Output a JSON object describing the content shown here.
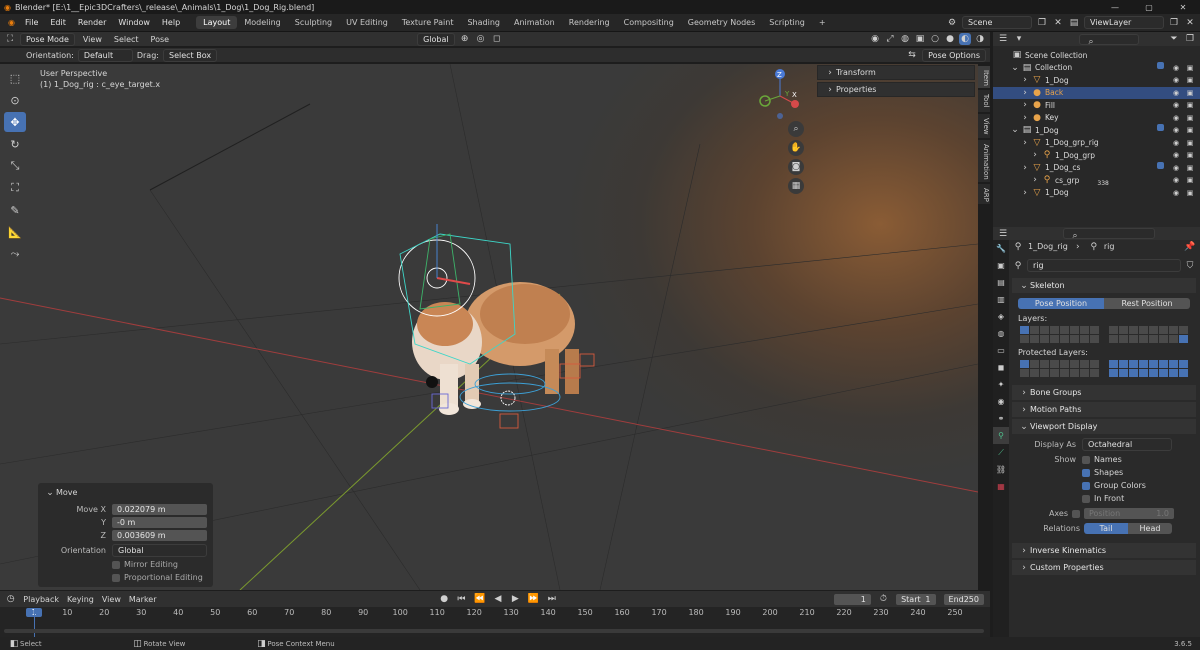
{
  "window": {
    "title": "Blender* [E:\\1__Epic3DCrafters\\_release\\_Animals\\1_Dog\\1_Dog_Rig.blend]",
    "min": "—",
    "max": "▢",
    "close": "✕"
  },
  "menu": [
    "File",
    "Edit",
    "Render",
    "Window",
    "Help"
  ],
  "workspaces": [
    "Layout",
    "Modeling",
    "Sculpting",
    "UV Editing",
    "Texture Paint",
    "Shading",
    "Animation",
    "Rendering",
    "Compositing",
    "Geometry Nodes",
    "Scripting"
  ],
  "workspace_add": "+",
  "scene": {
    "name": "Scene",
    "view_layer": "ViewLayer"
  },
  "viewport": {
    "mode": "Pose Mode",
    "menus": [
      "View",
      "Select",
      "Pose"
    ],
    "orientation_label": "Orientation:",
    "orientation": "Default",
    "drag_label": "Drag:",
    "drag": "Select Box",
    "transform": "Global",
    "pose_options": "Pose Options",
    "overlay_title": "User Perspective",
    "overlay_sub": "(1) 1_Dog_rig : c_eye_target.x",
    "side_items": [
      "Transform",
      "Properties"
    ],
    "tabs": [
      "Item",
      "Tool",
      "View",
      "Animation",
      "ARP"
    ],
    "gizmo": {
      "z": "Z",
      "x": "X",
      "y": "Y"
    }
  },
  "redo": {
    "title": "Move",
    "rows": [
      {
        "label": "Move X",
        "value": "0.022079 m"
      },
      {
        "label": "Y",
        "value": "-0 m"
      },
      {
        "label": "Z",
        "value": "0.003609 m"
      }
    ],
    "orientation_label": "Orientation",
    "orientation": "Global",
    "mirror": "Mirror Editing",
    "proportional": "Proportional Editing"
  },
  "timeline": {
    "menus": [
      "Playback",
      "Keying",
      "View",
      "Marker"
    ],
    "current": "1",
    "start_label": "Start",
    "start": "1",
    "end_label": "End",
    "end": "250",
    "ticks": [
      "1",
      "10",
      "20",
      "30",
      "40",
      "50",
      "60",
      "70",
      "80",
      "90",
      "100",
      "110",
      "120",
      "130",
      "140",
      "150",
      "160",
      "170",
      "180",
      "190",
      "200",
      "210",
      "220",
      "230",
      "240",
      "250"
    ]
  },
  "status": {
    "select": "Select",
    "rotate": "Rotate View",
    "context": "Pose Context Menu",
    "version": "3.6.5"
  },
  "outliner": {
    "rows": [
      {
        "label": "Scene Collection",
        "indent": 0
      },
      {
        "label": "Collection",
        "indent": 1
      },
      {
        "label": "1_Dog",
        "indent": 2
      },
      {
        "label": "Back",
        "indent": 2,
        "selected": true
      },
      {
        "label": "Fill",
        "indent": 2
      },
      {
        "label": "Key",
        "indent": 2
      },
      {
        "label": "1_Dog",
        "indent": 1
      },
      {
        "label": "1_Dog_grp_rig",
        "indent": 2
      },
      {
        "label": "1_Dog_grp",
        "indent": 3
      },
      {
        "label": "1_Dog_cs",
        "indent": 2
      },
      {
        "label": "cs_grp",
        "indent": 3,
        "badge": "338"
      },
      {
        "label": "1_Dog",
        "indent": 2
      }
    ]
  },
  "props": {
    "breadcrumb_obj": "1_Dog_rig",
    "breadcrumb_data": "rig",
    "data_name": "rig",
    "skeleton": "Skeleton",
    "pose_position": "Pose Position",
    "rest_position": "Rest Position",
    "layers": "Layers:",
    "protected_layers": "Protected Layers:",
    "bone_groups": "Bone Groups",
    "motion_paths": "Motion Paths",
    "viewport_display": "Viewport Display",
    "display_as_label": "Display As",
    "display_as": "Octahedral",
    "show_label": "Show",
    "names": "Names",
    "shapes": "Shapes",
    "group_colors": "Group Colors",
    "in_front": "In Front",
    "axes_label": "Axes",
    "axes_position": "Position",
    "axes_value": "1.0",
    "relations_label": "Relations",
    "tail": "Tail",
    "head": "Head",
    "ik": "Inverse Kinematics",
    "custom": "Custom Properties"
  }
}
